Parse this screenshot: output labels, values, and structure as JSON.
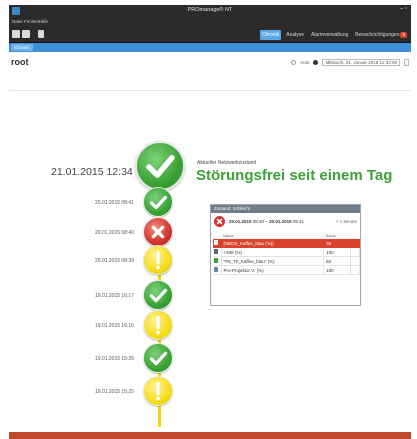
{
  "window": {
    "title": "PROmanage® NT",
    "controls": "– ▫"
  },
  "menu": {
    "items": [
      "Datei",
      "Fenster",
      "Hilfe"
    ]
  },
  "toolbar": {
    "tabs": [
      {
        "label": "Chronik",
        "active": true
      },
      {
        "label": "Analyse",
        "active": false
      },
      {
        "label": "Alarmverwaltung",
        "active": false
      },
      {
        "label": "Benachrichtigungen",
        "active": false
      }
    ],
    "badge": "5"
  },
  "subtab": {
    "label": "Chronik"
  },
  "page": {
    "root_label": "root",
    "auto_label": "Auto",
    "date_value": "Mittwoch, 21. Januar 2015 12:34:00"
  },
  "status": {
    "current_timestamp": "21.01.2015 12:34",
    "title": "Aktueller Netzwerkzustand",
    "message": "Störungsfrei seit einem Tag"
  },
  "events": [
    {
      "timestamp": "20.01.2015 08:41",
      "state": "ok"
    },
    {
      "timestamp": "20.01.2015 08:40",
      "state": "error"
    },
    {
      "timestamp": "20.01.2015 08:39",
      "state": "warning"
    },
    {
      "timestamp": "19.01.2015 16:17",
      "state": "ok"
    },
    {
      "timestamp": "19.01.2015 16:16",
      "state": "warning"
    },
    {
      "timestamp": "19.01.2015 15:26",
      "state": "ok"
    },
    {
      "timestamp": "19.01.2015 15:25",
      "state": "warning"
    }
  ],
  "panel": {
    "header": "Zustand: Schlecht",
    "range_start": "20.01.2015",
    "range_start_time": "08:40",
    "range_end": "20.01.2015",
    "range_end_time": "08:41",
    "duration": "< 1 Minute",
    "columns": [
      "Name",
      "Schw."
    ],
    "rows": [
      {
        "name": "[NBOX_Kaffee_blau (%)]",
        "value": "30",
        "alarm": true,
        "icon": "sensor-icon"
      },
      {
        "name": "+208 (%)",
        "value": "100",
        "alarm": false,
        "icon": "sensor-icon"
      },
      {
        "name": "\"P8_Th_Kaffee_blau\" (%)",
        "value": "60",
        "alarm": false,
        "icon": "plant-icon"
      },
      {
        "name": "Pro-Projektor V: (%)",
        "value": "100",
        "alarm": false,
        "icon": "device-icon"
      }
    ]
  },
  "colors": {
    "ok": "#3aa335",
    "error": "#d0342c",
    "warning": "#f6dc1a",
    "accent": "#5aa9e6",
    "alarm_row": "#d9432c"
  }
}
